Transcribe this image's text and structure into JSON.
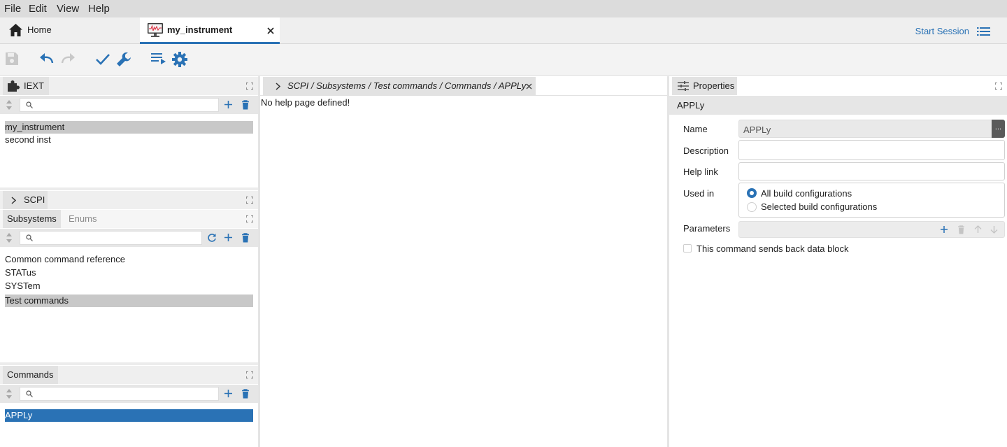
{
  "menu": {
    "file": "File",
    "edit": "Edit",
    "view": "View",
    "help": "Help"
  },
  "tabs": {
    "home": "Home",
    "instrument": "my_instrument",
    "start_session": "Start Session"
  },
  "left": {
    "iext": {
      "title": "IEXT",
      "search_placeholder": "",
      "items": [
        "my_instrument",
        "second inst"
      ],
      "selected": 0
    },
    "scpi": {
      "title": "SCPI",
      "tab_subsystems": "Subsystems",
      "tab_enums": "Enums",
      "search_placeholder": "",
      "items": [
        "Common command reference",
        "STATus",
        "SYSTem",
        "Test commands"
      ],
      "selected": 3
    },
    "commands": {
      "title": "Commands",
      "search_placeholder": "",
      "items": [
        "APPLy"
      ],
      "selected": 0
    }
  },
  "center": {
    "breadcrumb": "SCPI / Subsystems / Test commands / Commands / APPLy",
    "help_text": "No help page defined!"
  },
  "properties": {
    "tab_title": "Properties",
    "header": "APPLy",
    "name_label": "Name",
    "name_value": "APPLy",
    "description_label": "Description",
    "description_value": "",
    "help_link_label": "Help link",
    "help_link_value": "",
    "used_in_label": "Used in",
    "option_all": "All build configurations",
    "option_selected": "Selected build configurations",
    "parameters_label": "Parameters",
    "data_block_label": "This command sends back data block",
    "ellipsis": "..."
  },
  "colors": {
    "accent": "#2a72b5",
    "selection_gray": "#c8c8c8"
  }
}
